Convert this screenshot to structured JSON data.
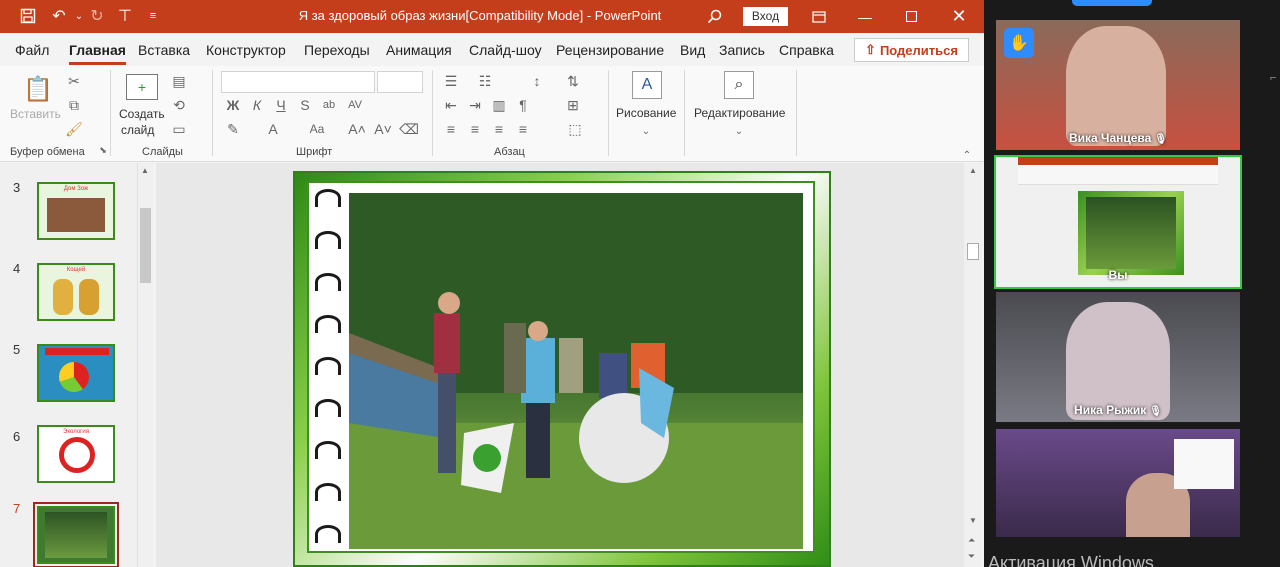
{
  "window": {
    "title": "Я за здоровый образ жизни[Compatibility Mode] - PowerPoint",
    "signin_label": "Вход"
  },
  "menu": {
    "tabs": [
      {
        "label": "Файл"
      },
      {
        "label": "Главная"
      },
      {
        "label": "Вставка"
      },
      {
        "label": "Конструктор"
      },
      {
        "label": "Переходы"
      },
      {
        "label": "Анимация"
      },
      {
        "label": "Слайд-шоу"
      },
      {
        "label": "Рецензирование"
      },
      {
        "label": "Вид"
      },
      {
        "label": "Запись"
      },
      {
        "label": "Справка"
      }
    ],
    "share_label": "Поделиться"
  },
  "ribbon": {
    "clipboard": {
      "paste_label": "Вставить",
      "group_label": "Буфер обмена"
    },
    "slides": {
      "new_slide_line1": "Создать",
      "new_slide_line2": "слайд",
      "group_label": "Слайды"
    },
    "font": {
      "group_label": "Шрифт",
      "bold": "Ж",
      "italic": "К",
      "underline": "Ч",
      "strike": "S",
      "case": "Aa"
    },
    "paragraph": {
      "group_label": "Абзац"
    },
    "drawing": {
      "label": "Рисование"
    },
    "editing": {
      "label": "Редактирование"
    }
  },
  "slides_pane": {
    "thumbs": [
      {
        "num": "3",
        "title": "Дом Зож"
      },
      {
        "num": "4",
        "title": "Кощей"
      },
      {
        "num": "5",
        "title": ""
      },
      {
        "num": "6",
        "title": "Экология"
      },
      {
        "num": "7",
        "title": ""
      }
    ],
    "selected": "7"
  },
  "participants": [
    {
      "name": "Вика Чанцева",
      "muted": true
    },
    {
      "name": "Вы",
      "muted": false
    },
    {
      "name": "Ника Рыжик",
      "muted": true
    },
    {
      "name": "",
      "muted": false
    }
  ],
  "system": {
    "activation_text": "Активация Windows"
  },
  "colors": {
    "accent": "#c43e1c",
    "zoom_active": "#2ecc40",
    "hand": "#2e8cff"
  },
  "icons": [
    "save-icon",
    "undo-icon",
    "redo-icon",
    "pin-icon",
    "search-icon",
    "minimize-icon",
    "maximize-icon",
    "close-icon",
    "raise-hand-icon",
    "mic-muted-icon"
  ]
}
